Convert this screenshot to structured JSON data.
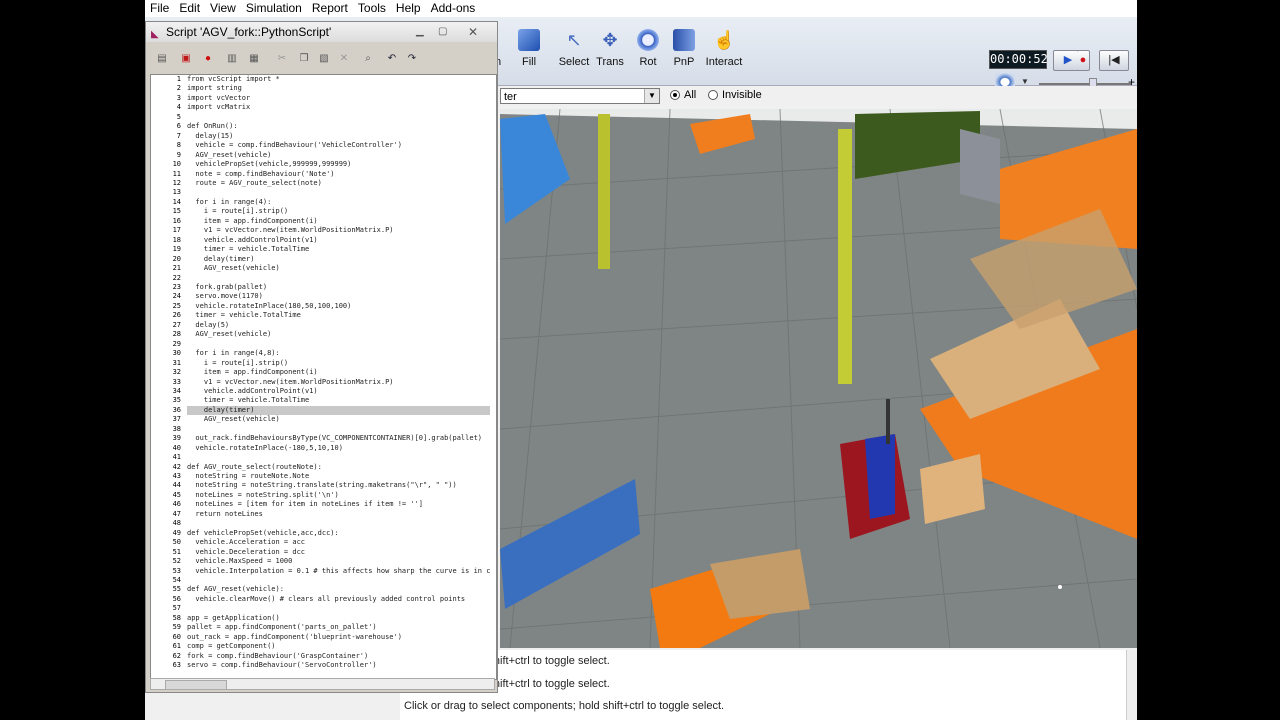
{
  "menu": [
    "File",
    "Edit",
    "View",
    "Simulation",
    "Report",
    "Tools",
    "Help",
    "Add-ons"
  ],
  "toolbar": {
    "cut_label": "n",
    "tools": [
      {
        "label": "Fill",
        "icon": "fill-cube-icon"
      },
      {
        "label": "Select",
        "icon": "select-arrow-icon"
      },
      {
        "label": "Trans",
        "icon": "translate-icon"
      },
      {
        "label": "Rot",
        "icon": "rotate-icon"
      },
      {
        "label": "PnP",
        "icon": "pnp-icon"
      },
      {
        "label": "Interact",
        "icon": "interact-icon"
      }
    ]
  },
  "simulation": {
    "time": "00:00:52",
    "play": "▶",
    "record": "●",
    "reset": "|◀"
  },
  "filter": {
    "combo_value": "ter",
    "all_label": "All",
    "invisible_label": "Invisible"
  },
  "console": {
    "line1": "omponents; hold shift+ctrl to toggle select.",
    "line2": "omponents; hold shift+ctrl to toggle select.",
    "line3": "Click or drag to select components; hold shift+ctrl to toggle select."
  },
  "script": {
    "title": "Script 'AGV_fork::PythonScript'",
    "lines": [
      "from vcScript import *",
      "import string",
      "import vcVector",
      "import vcMatrix",
      "",
      "def OnRun():",
      "  delay(15)",
      "  vehicle = comp.findBehaviour('VehicleController')",
      "  AGV_reset(vehicle)",
      "  vehiclePropSet(vehicle,999999,999999)",
      "  note = comp.findBehaviour('Note')",
      "  route = AGV_route_select(note)",
      "",
      "  for i in range(4):",
      "    i = route[i].strip()",
      "    item = app.findComponent(i)",
      "    v1 = vcVector.new(item.WorldPositionMatrix.P)",
      "    vehicle.addControlPoint(v1)",
      "    timer = vehicle.TotalTime",
      "    delay(timer)",
      "    AGV_reset(vehicle)",
      "",
      "  fork.grab(pallet)",
      "  servo.move(1170)",
      "  vehicle.rotateInPlace(180,50,100,100)",
      "  timer = vehicle.TotalTime",
      "  delay(5)",
      "  AGV_reset(vehicle)",
      "",
      "  for i in range(4,8):",
      "    i = route[i].strip()",
      "    item = app.findComponent(i)",
      "    v1 = vcVector.new(item.WorldPositionMatrix.P)",
      "    vehicle.addControlPoint(v1)",
      "    timer = vehicle.TotalTime",
      "    delay(timer)",
      "    AGV_reset(vehicle)",
      "",
      "  out_rack.findBehavioursByType(VC_COMPONENTCONTAINER)[0].grab(pallet)",
      "  vehicle.rotateInPlace(-180,5,10,10)",
      "",
      "def AGV_route_select(routeNote):",
      "  noteString = routeNote.Note",
      "  noteString = noteString.translate(string.maketrans(\"\\r\", \" \"))",
      "  noteLines = noteString.split('\\n')",
      "  noteLines = [item for item in noteLines if item != '']",
      "  return noteLines",
      "",
      "def vehiclePropSet(vehicle,acc,dcc):",
      "  vehicle.Acceleration = acc",
      "  vehicle.Deceleration = dcc",
      "  vehicle.MaxSpeed = 1000",
      "  vehicle.Interpolation = 0.1 # this affects how sharp the curve is in c",
      "",
      "def AGV_reset(vehicle):",
      "  vehicle.clearMove() # clears all previously added control points",
      "",
      "app = getApplication()",
      "pallet = app.findComponent('parts_on_pallet')",
      "out_rack = app.findComponent('blueprint-warehouse')",
      "comp = getComponent()",
      "fork = comp.findBehaviour('GraspContainer')",
      "servo = comp.findBehaviour('ServoController')"
    ]
  }
}
